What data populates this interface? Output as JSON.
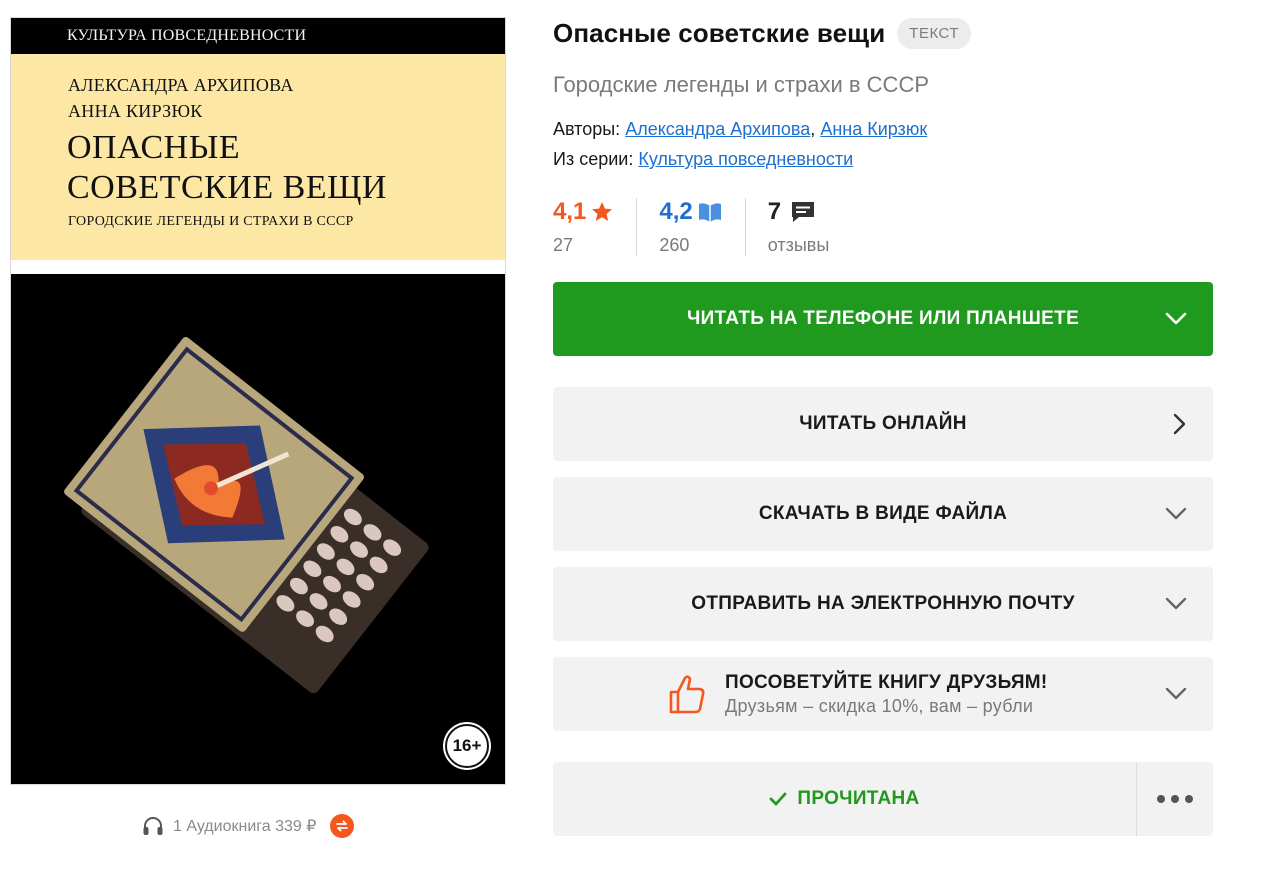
{
  "cover": {
    "series_banner": "КУЛЬТУРА ПОВСЕДНЕВНОСТИ",
    "author_1": "АЛЕКСАНДРА АРХИПОВА",
    "author_2": "АННА КИРЗЮК",
    "title_line_1": "ОПАСНЫЕ",
    "title_line_2": "СОВЕТСКИЕ ВЕЩИ",
    "subtitle": "ГОРОДСКИЕ ЛЕГЕНДЫ И СТРАХИ В СССР",
    "age_rating": "16+"
  },
  "audio": {
    "label": "1 Аудиокнига 339 ₽",
    "headphones_icon": "headphones-icon",
    "swap_icon": "swap-arrows-icon"
  },
  "book": {
    "title": "Опасные советские вещи",
    "type_badge": "ТЕКСТ",
    "subtitle": "Городские легенды и страхи в СССР",
    "authors_label": "Авторы:",
    "authors": [
      "Александра Архипова",
      "Анна Кирзюк"
    ],
    "authors_separator": ",",
    "series_label": "Из серии:",
    "series": "Культура повседневности"
  },
  "ratings": {
    "litres_value": "4,1",
    "litres_count": "27",
    "livelib_value": "4,2",
    "livelib_count": "260",
    "reviews_value": "7",
    "reviews_label": "отзывы"
  },
  "buttons": {
    "read_on_device": "ЧИТАТЬ НА ТЕЛЕФОНЕ ИЛИ ПЛАНШЕТЕ",
    "read_online": "ЧИТАТЬ ОНЛАЙН",
    "download_file": "СКАЧАТЬ В ВИДЕ ФАЙЛА",
    "send_email": "ОТПРАВИТЬ НА ЭЛЕКТРОННУЮ ПОЧТУ",
    "recommend_title": "ПОСОВЕТУЙТЕ КНИГУ ДРУЗЬЯМ!",
    "recommend_sub": "Друзьям – скидка 10%, вам – рубли",
    "read_status": "ПРОЧИТАНА"
  },
  "colors": {
    "green": "#1f9a1f",
    "orange": "#f4581f",
    "blue": "#1e6fd0",
    "livelib_blue": "#4a90e2",
    "cover_yellow": "#fde7a5"
  }
}
